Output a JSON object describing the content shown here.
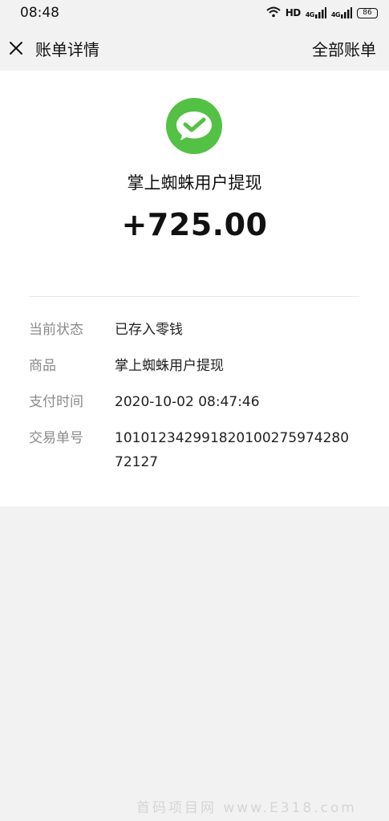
{
  "status_bar": {
    "time": "08:48",
    "network_label": "HD",
    "signal1_label": "4G",
    "signal2_label": "4G",
    "battery": "86"
  },
  "nav": {
    "title": "账单详情",
    "right_link": "全部账单"
  },
  "bill": {
    "merchant": "掌上蜘蛛用户提现",
    "amount": "+725.00",
    "details": [
      {
        "label": "当前状态",
        "value": "已存入零钱"
      },
      {
        "label": "商品",
        "value": "掌上蜘蛛用户提现"
      },
      {
        "label": "支付时间",
        "value": "2020-10-02 08:47:46"
      },
      {
        "label": "交易单号",
        "value": "101012342991820100275974280 72127"
      }
    ]
  },
  "watermark": "首码项目网 www.E318.com",
  "colors": {
    "brand_green": "#53c144",
    "background": "#f2f2f2"
  }
}
